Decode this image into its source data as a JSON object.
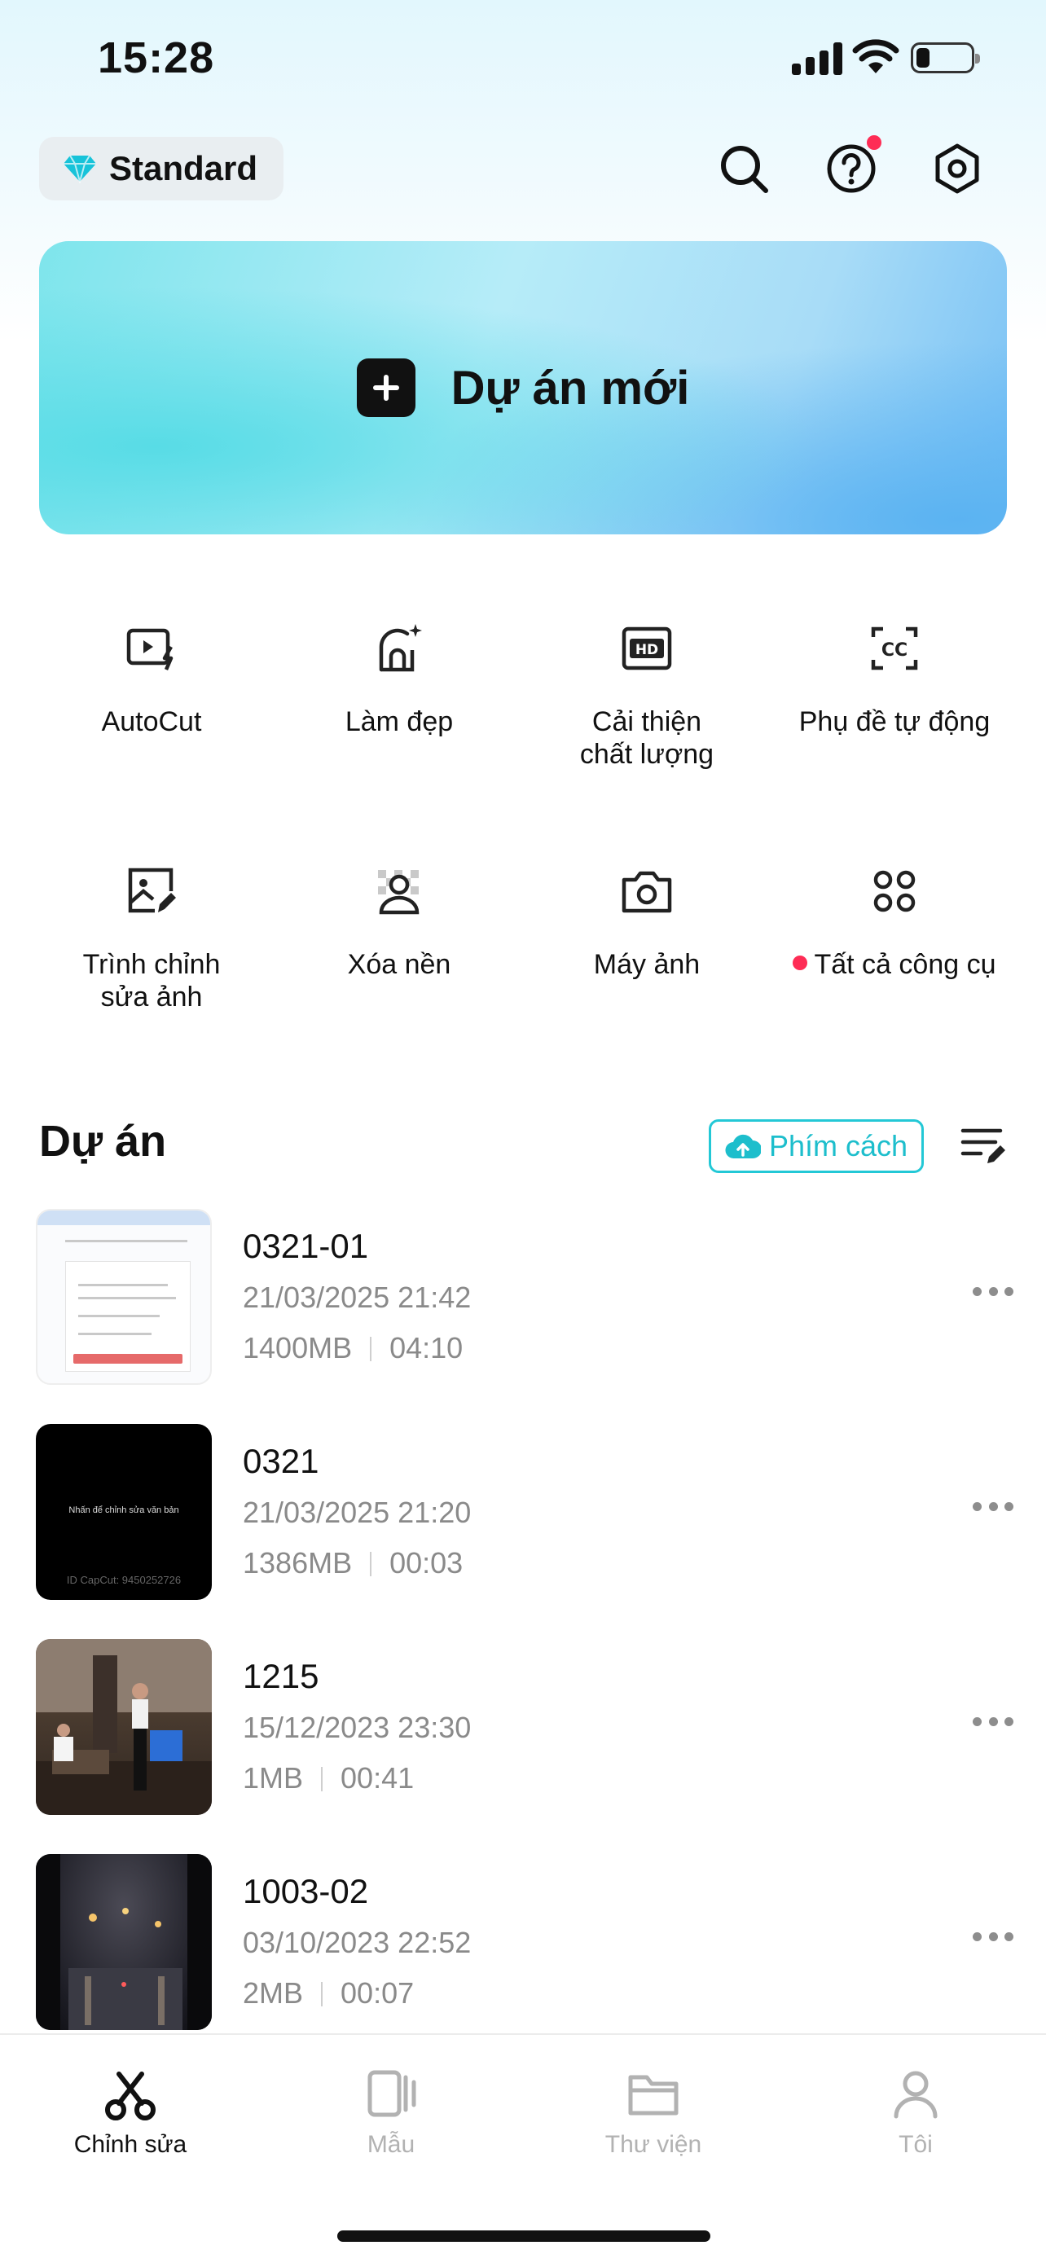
{
  "status_bar": {
    "time": "15:28"
  },
  "header": {
    "plan_label": "Standard",
    "icons": [
      "search-icon",
      "help-icon",
      "settings-icon"
    ],
    "colors": {
      "diamond": "#17c3d9",
      "notification_dot": "#fe2c55"
    }
  },
  "new_project": {
    "label": "Dự án mới"
  },
  "tools": [
    {
      "label": "AutoCut",
      "icon": "autocut-icon"
    },
    {
      "label": "Làm đẹp",
      "icon": "beauty-icon"
    },
    {
      "label": "Cải thiện\nchất lượng",
      "icon": "hd-icon"
    },
    {
      "label": "Phụ đề tự động",
      "icon": "captions-icon"
    },
    {
      "label": "Trình chỉnh\nsửa ảnh",
      "icon": "photo-edit-icon"
    },
    {
      "label": "Xóa nền",
      "icon": "remove-background-icon"
    },
    {
      "label": "Máy ảnh",
      "icon": "camera-icon"
    },
    {
      "label": "Tất cả công cụ",
      "icon": "all-tools-icon",
      "has_dot": true
    }
  ],
  "projects_section": {
    "title": "Dự án",
    "space_button": "Phím cách",
    "accent": "#1dbecc"
  },
  "projects": [
    {
      "name": "0321-01",
      "date": "21/03/2025 21:42",
      "size": "1400MB",
      "duration": "04:10"
    },
    {
      "name": "0321",
      "date": "21/03/2025 21:20",
      "size": "1386MB",
      "duration": "00:03",
      "thumb_text": "Nhấn để chỉnh sửa văn bản",
      "thumb_id": "ID CapCut: 9450252726"
    },
    {
      "name": "1215",
      "date": "15/12/2023 23:30",
      "size": "1MB",
      "duration": "00:41"
    },
    {
      "name": "1003-02",
      "date": "03/10/2023 22:52",
      "size": "2MB",
      "duration": "00:07"
    }
  ],
  "tab_bar": {
    "tabs": [
      {
        "label": "Chỉnh sửa",
        "icon": "scissors-icon",
        "active": true
      },
      {
        "label": "Mẫu",
        "icon": "template-icon",
        "active": false
      },
      {
        "label": "Thư viện",
        "icon": "folder-icon",
        "active": false
      },
      {
        "label": "Tôi",
        "icon": "profile-icon",
        "active": false
      }
    ]
  }
}
